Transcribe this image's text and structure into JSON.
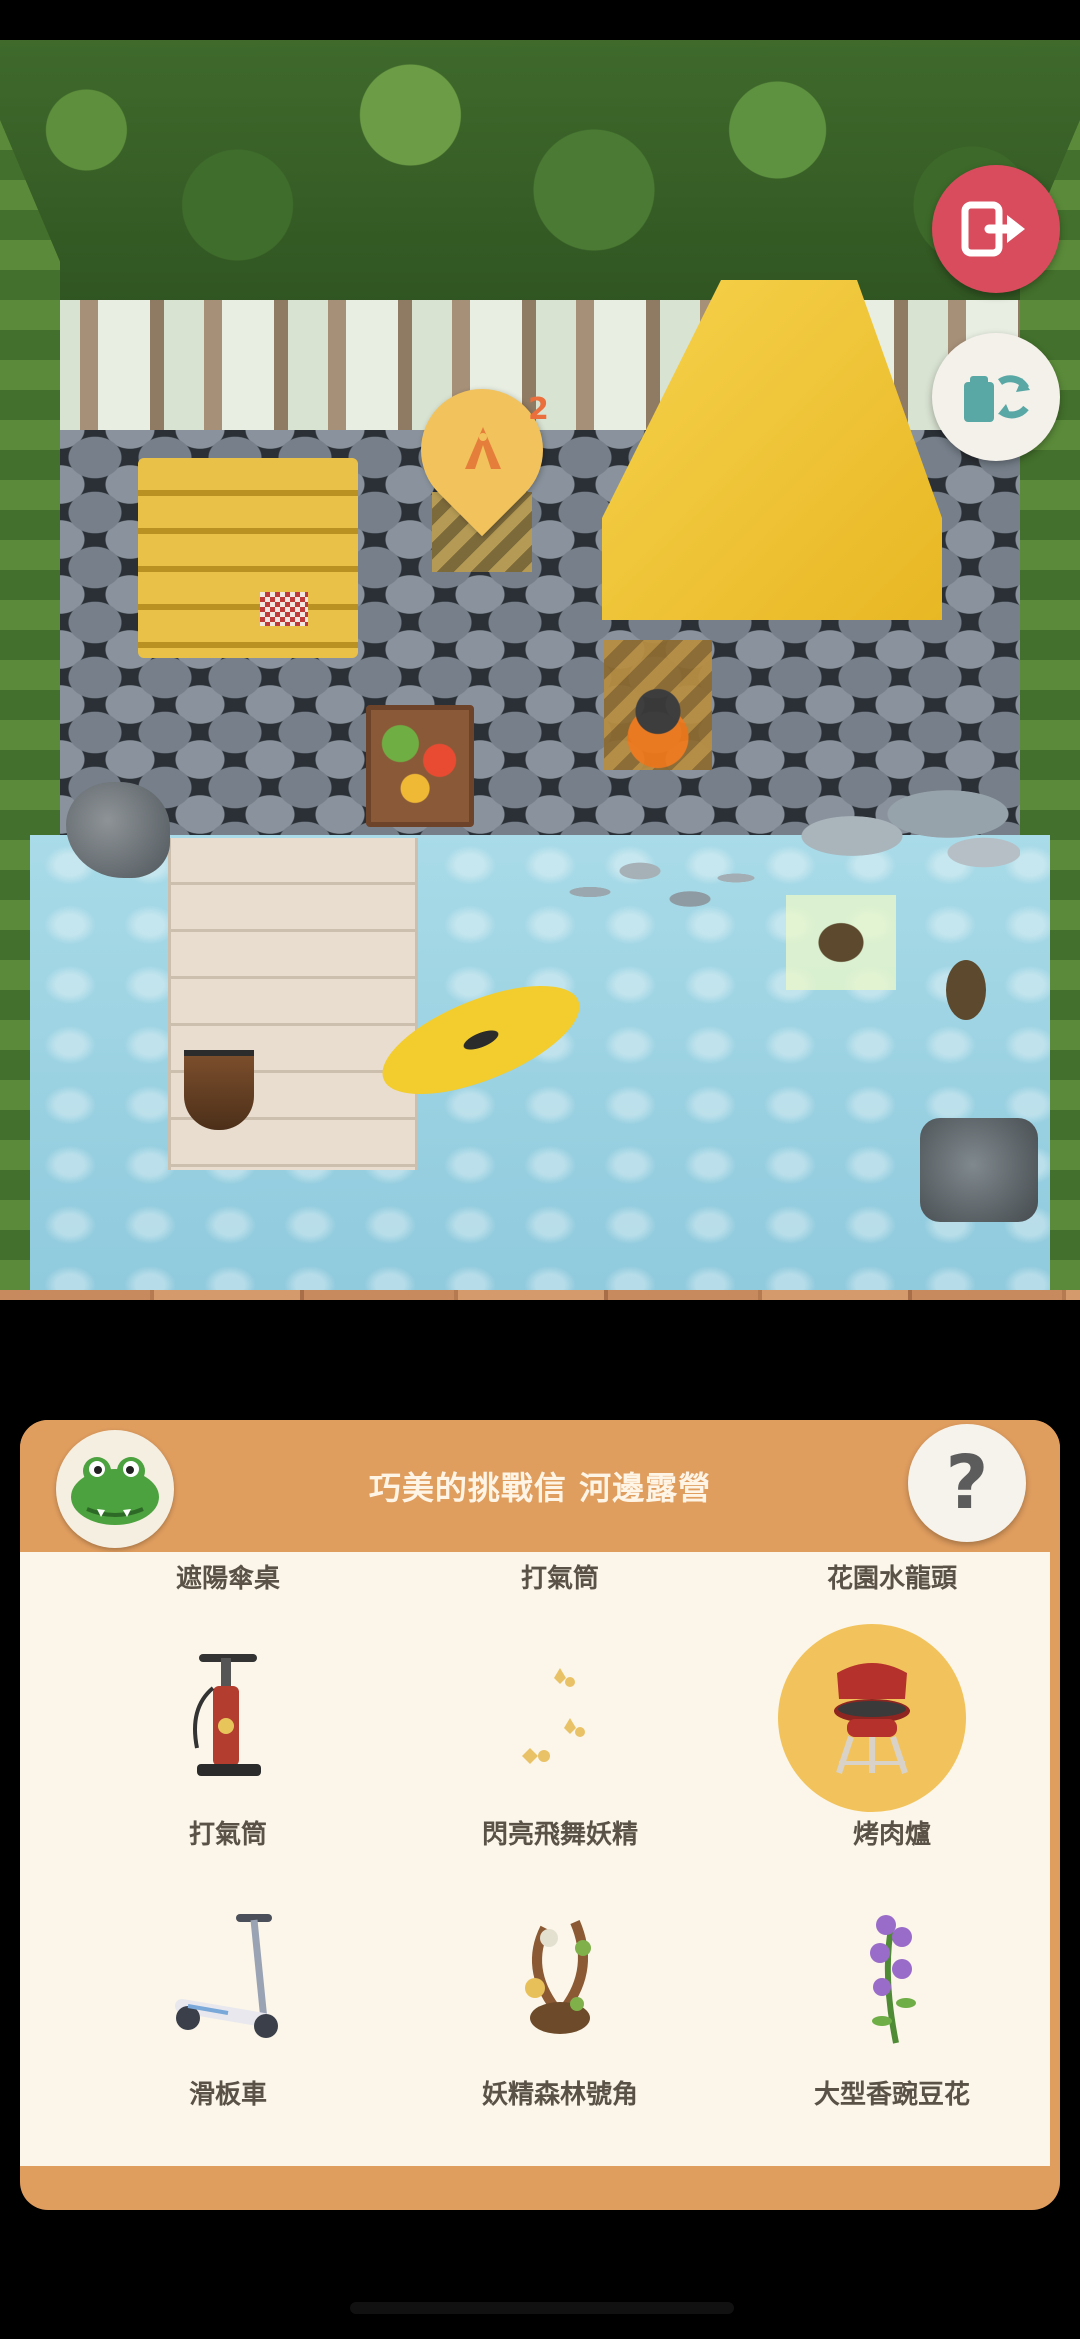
{
  "scene": {
    "map_pin": {
      "icon": "campsite-icon",
      "count": "2"
    },
    "buttons": {
      "exit": "exit-icon",
      "swap": "swap-furniture-icon"
    }
  },
  "panel": {
    "title": "巧美的挑戰信 河邊露營",
    "avatar_icon": "crocodile-avatar",
    "help_label": "?",
    "top_row": [
      "遮陽傘桌",
      "打氣筒",
      "花園水龍頭"
    ],
    "items": [
      {
        "label": "打氣筒",
        "icon": "air-pump-icon",
        "selected": false
      },
      {
        "label": "閃亮飛舞妖精",
        "icon": "fairy-sparkle-icon",
        "selected": false
      },
      {
        "label": "烤肉爐",
        "icon": "bbq-grill-icon",
        "selected": true
      },
      {
        "label": "滑板車",
        "icon": "scooter-icon",
        "selected": false
      },
      {
        "label": "妖精森林號角",
        "icon": "fairy-horn-icon",
        "selected": false
      },
      {
        "label": "大型香豌豆花",
        "icon": "sweet-pea-icon",
        "selected": false
      }
    ]
  },
  "colors": {
    "panel": "#df9d5e",
    "accent": "#f2c35c",
    "exit": "#d94c5e"
  }
}
